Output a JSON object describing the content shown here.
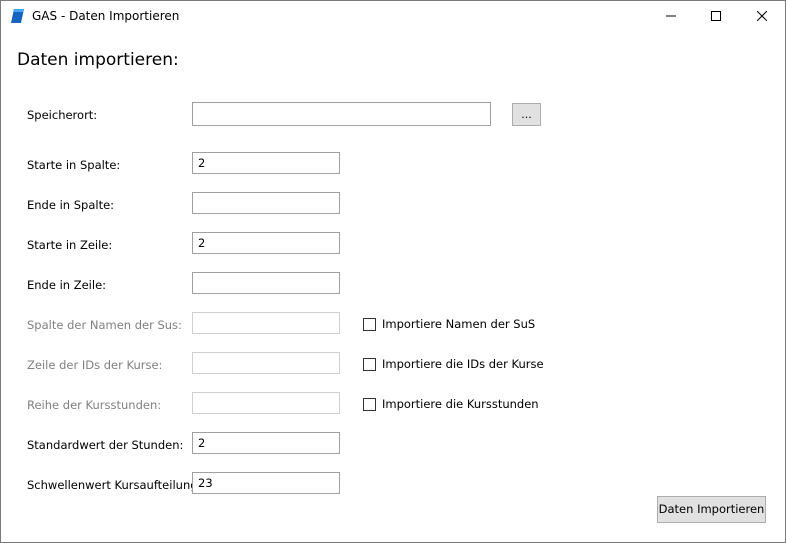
{
  "window": {
    "title": "GAS - Daten Importieren",
    "icon": "app-logo-icon",
    "controls": [
      "minimize-icon",
      "maximize-icon",
      "close-icon"
    ]
  },
  "heading": "Daten importieren:",
  "storage": {
    "label": "Speicherort:",
    "value": "",
    "browse_label": "..."
  },
  "fields": {
    "start_column": {
      "label": "Starte in Spalte:",
      "value": "2"
    },
    "end_column": {
      "label": "Ende in Spalte:",
      "value": ""
    },
    "start_row": {
      "label": "Starte in Zeile:",
      "value": "2"
    },
    "end_row": {
      "label": "Ende in Zeile:",
      "value": ""
    },
    "names_column": {
      "label": "Spalte der Namen der Sus:",
      "value": "",
      "enabled": false
    },
    "course_ids_row": {
      "label": "Zeile der IDs der Kurse:",
      "value": "",
      "enabled": false
    },
    "course_hours_row": {
      "label": "Reihe der Kursstunden:",
      "value": "",
      "enabled": false
    },
    "default_hours": {
      "label": "Standardwert der Stunden:",
      "value": "2"
    },
    "split_threshold": {
      "label": "Schwellenwert Kursaufteilung:",
      "value": "23"
    }
  },
  "checkboxes": {
    "import_names": {
      "label": "Importiere Namen der SuS",
      "checked": false
    },
    "import_course_ids": {
      "label": "Importiere die IDs der Kurse",
      "checked": false
    },
    "import_course_hours": {
      "label": "Importiere die Kursstunden",
      "checked": false
    }
  },
  "actions": {
    "import_label": "Daten Importieren"
  },
  "colors": {
    "icon_blue": "#1565c0",
    "disabled_text": "#808080",
    "button_face": "#e1e1e1"
  }
}
